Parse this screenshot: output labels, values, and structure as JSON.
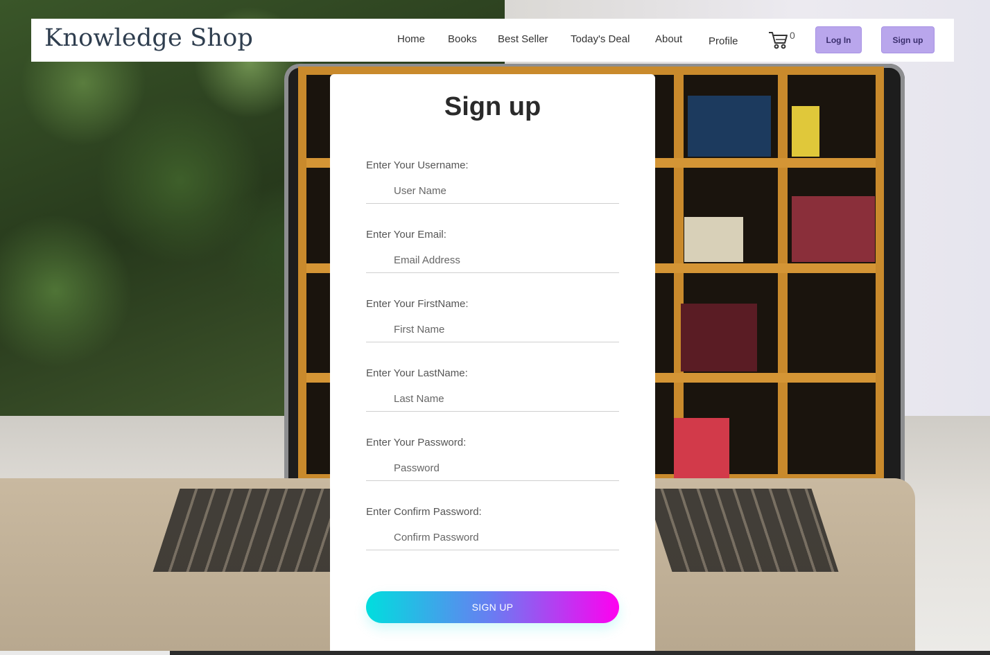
{
  "header": {
    "brand": "Knowledge Shop",
    "nav": [
      "Home",
      "Books",
      "Best Seller",
      "Today's Deal",
      "About",
      "Profile"
    ],
    "cart_count": "0",
    "login_label": "Log In",
    "signup_label": "Sign up"
  },
  "form": {
    "title": "Sign up",
    "fields": [
      {
        "label": "Enter Your Username:",
        "placeholder": "User Name",
        "value": ""
      },
      {
        "label": "Enter Your Email:",
        "placeholder": "Email Address",
        "value": ""
      },
      {
        "label": "Enter Your FirstName:",
        "placeholder": "First Name",
        "value": ""
      },
      {
        "label": "Enter Your LastName:",
        "placeholder": "Last Name",
        "value": ""
      },
      {
        "label": "Enter Your Password:",
        "placeholder": "Password",
        "value": ""
      },
      {
        "label": "Enter Confirm Password:",
        "placeholder": "Confirm Password",
        "value": ""
      }
    ],
    "submit_label": "SIGN UP"
  },
  "icons": {
    "cart": "cart-icon"
  },
  "colors": {
    "header_button": "#b9a6ec",
    "gradient_start": "#00dede",
    "gradient_end": "#ff00f0",
    "brand_text": "#2f3e4f"
  }
}
